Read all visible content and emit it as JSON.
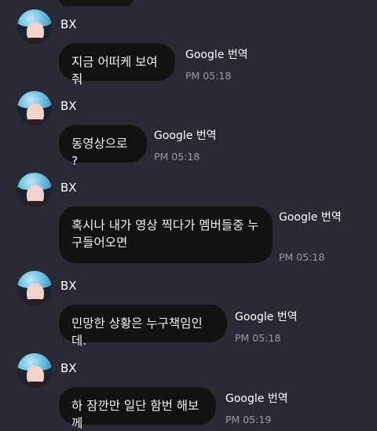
{
  "messages": [
    {
      "sender": "BX",
      "text": "지금 어떠케 보여줘",
      "translate_label": "Google 번역",
      "time": "PM 05:18"
    },
    {
      "sender": "BX",
      "text": "동영상으로 ?",
      "translate_label": "Google 번역",
      "time": "PM 05:18"
    },
    {
      "sender": "BX",
      "text": "혹시나 내가 영상 찍다가 멤버들중 누구들어오면",
      "translate_label": "Google 번역",
      "time": "PM 05:18"
    },
    {
      "sender": "BX",
      "text": "민망한 상황은 누구책임인데.",
      "translate_label": "Google 번역",
      "time": "PM 05:18"
    },
    {
      "sender": "BX",
      "text": "하 잠깐만 일단 함번 해보께",
      "translate_label": "Google 번역",
      "time": "PM 05:19"
    }
  ],
  "colors": {
    "background": "#2a2a37",
    "bubble": "#121212",
    "time_text": "#9a9aa6"
  },
  "icons": {
    "avatar": "profile-photo-blue-hair"
  }
}
